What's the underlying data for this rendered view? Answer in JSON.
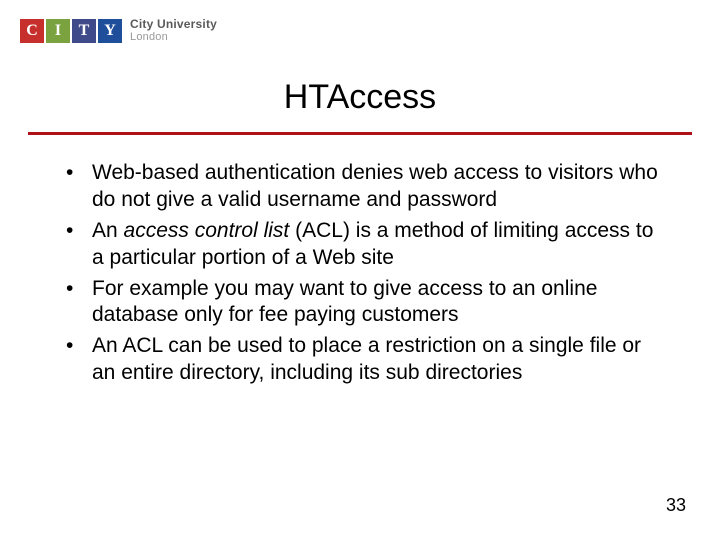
{
  "logo": {
    "tiles": [
      "C",
      "I",
      "T",
      "Y"
    ],
    "line1": "City University",
    "line2": "London"
  },
  "title": "HTAccess",
  "bullets": [
    {
      "prefix": "Web-based authentication denies web access to visitors who do not give a valid username and password",
      "italic": "",
      "suffix": ""
    },
    {
      "prefix": "An ",
      "italic": "access control list",
      "suffix": " (ACL) is a method of limiting access to a particular portion of a Web site"
    },
    {
      "prefix": "For example you may want to give access to an online database only for fee paying customers",
      "italic": "",
      "suffix": ""
    },
    {
      "prefix": "An ACL can be used to place a restriction on a single file or an entire directory, including its sub directories",
      "italic": "",
      "suffix": ""
    }
  ],
  "page_number": "33"
}
